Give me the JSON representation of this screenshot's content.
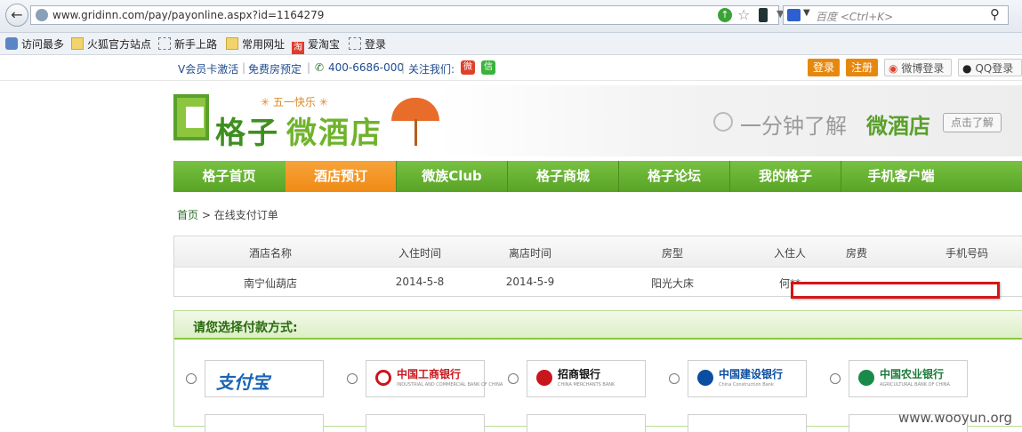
{
  "browser": {
    "url": "www.gridinn.com/pay/payonline.aspx?id=1164279",
    "search_placeholder": "百度 <Ctrl+K>",
    "bookmarks": [
      "访问最多",
      "火狐官方站点",
      "新手上路",
      "常用网址",
      "爱淘宝",
      "登录"
    ]
  },
  "topbar": {
    "vip": "V会员卡激活",
    "free_booking": "免费房预定",
    "phone": "400-6686-000",
    "follow": "关注我们:",
    "login": "登录",
    "register": "注册",
    "weibo_login": "微博登录",
    "qq_login": "QQ登录"
  },
  "header": {
    "logo_part1": "格子",
    "logo_part2": "微酒店",
    "promo": "五一快乐",
    "slogan_gray": "一分钟了解",
    "slogan_green": "微酒店",
    "slogan_button": "点击了解"
  },
  "nav": {
    "items": [
      "格子首页",
      "酒店预订",
      "微族Club",
      "格子商城",
      "格子论坛",
      "我的格子",
      "手机客户端"
    ],
    "active_index": 1
  },
  "breadcrumb": {
    "home": "首页",
    "current": "在线支付订单"
  },
  "order": {
    "columns": [
      "酒店名称",
      "入住时间",
      "离店时间",
      "房型",
      "入住人",
      "房费",
      "手机号码"
    ],
    "row": [
      "南宁仙葫店",
      "2014-5-8",
      "2014-5-9",
      "阳光大床",
      "何**",
      "",
      ""
    ]
  },
  "payment": {
    "title": "请您选择付款方式:",
    "methods": [
      {
        "name": "支付宝",
        "sub": ""
      },
      {
        "name": "中国工商银行",
        "sub": "INDUSTRIAL AND COMMERCIAL BANK OF CHINA"
      },
      {
        "name": "招商银行",
        "sub": "CHINA MERCHANTS BANK"
      },
      {
        "name": "中国建设银行",
        "sub": "China Construction Bank"
      },
      {
        "name": "中国农业银行",
        "sub": "AGRICULTURAL BANK OF CHINA"
      }
    ]
  },
  "watermark": "www.wooyun.org",
  "colors": {
    "nav_green": "#6cb335",
    "nav_active": "#f39422",
    "accent_orange": "#e7880e",
    "redact_border": "#d81414"
  }
}
